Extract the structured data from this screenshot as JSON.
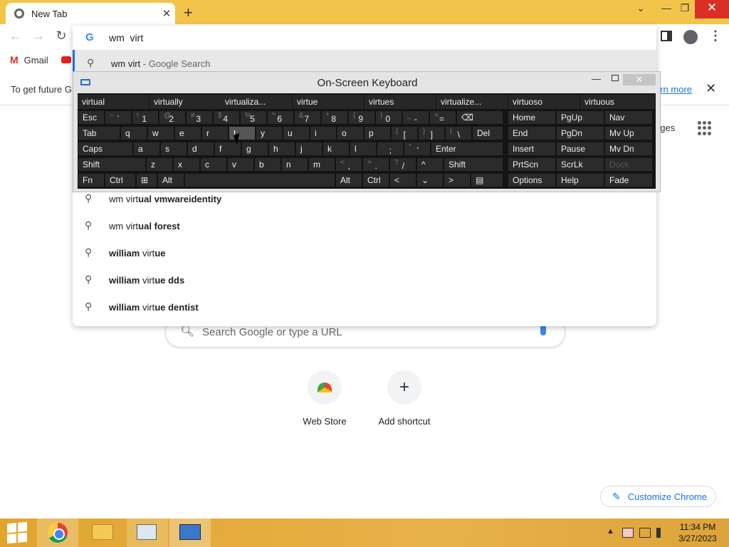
{
  "browser": {
    "tab_title": "New Tab",
    "tab_close": "✕",
    "new_tab": "+",
    "window_controls": {
      "chevron": "⌄",
      "minimize": "—",
      "maximize": "❐",
      "close": "✕"
    },
    "toolbar": {
      "back": "←",
      "forward": "→",
      "reload": "↻",
      "menu": "⋮"
    },
    "bookmarks": [
      {
        "label": "Gmail",
        "icon": "gmail-icon"
      },
      {
        "label": "",
        "icon": "youtube-icon"
      }
    ],
    "infobar": {
      "text": "To get future G",
      "link": "arn more",
      "close": "✕"
    }
  },
  "omnibox": {
    "g_logo": "G",
    "input_value": "wm  virt",
    "suggestions": [
      {
        "pre": "wm virt",
        "bold": "",
        "sub": " - Google Search"
      },
      {
        "pre": "wm virt",
        "bold": "ual vmwareidentity",
        "sub": ""
      },
      {
        "pre": "wm virt",
        "bold": "ual forest",
        "sub": ""
      },
      {
        "bold_pre": "william ",
        "pre": "virt",
        "bold": "ue",
        "sub": ""
      },
      {
        "bold_pre": "william ",
        "pre": "virt",
        "bold": "ue dds",
        "sub": ""
      },
      {
        "bold_pre": "william ",
        "pre": "virt",
        "bold": "ue dentist",
        "sub": ""
      }
    ]
  },
  "newtab": {
    "images_link": "ages",
    "search_placeholder": "Search Google or type a URL",
    "shortcuts": [
      {
        "label": "Web Store"
      },
      {
        "label": "Add shortcut",
        "glyph": "+"
      }
    ],
    "customize": "Customize Chrome"
  },
  "osk": {
    "title": "On-Screen Keyboard",
    "min": "—",
    "close": "✕",
    "predictions": [
      "virtual",
      "virtually",
      "virtualiza...",
      "virtue",
      "virtues",
      "virtualize...",
      "virtuoso",
      "virtuous"
    ],
    "keys": {
      "esc": "Esc",
      "tab": "Tab",
      "caps": "Caps",
      "shift_l": "Shift",
      "fn": "Fn",
      "ctrl_l": "Ctrl",
      "alt_l": "Alt",
      "del": "Del",
      "enter": "Enter",
      "shift_r": "Shift",
      "alt_r": "Alt",
      "ctrl_r": "Ctrl",
      "lt": "<",
      "down": "⌄",
      "gt": ">",
      "up": "^",
      "home": "Home",
      "pgup": "PgUp",
      "nav": "Nav",
      "end": "End",
      "pgdn": "PgDn",
      "mvup": "Mv Up",
      "insert": "Insert",
      "pause": "Pause",
      "mvdn": "Mv Dn",
      "prtscn": "PrtScn",
      "scrlk": "ScrLk",
      "dock": "Dock",
      "options": "Options",
      "help": "Help",
      "fade": "Fade",
      "row1": [
        [
          "~",
          "`"
        ],
        [
          "!",
          "1"
        ],
        [
          "@",
          "2"
        ],
        [
          "#",
          "3"
        ],
        [
          "$",
          "4"
        ],
        [
          "%",
          "5"
        ],
        [
          "^",
          "6"
        ],
        [
          "&",
          "7"
        ],
        [
          "*",
          "8"
        ],
        [
          "(",
          "9"
        ],
        [
          ")",
          "0"
        ],
        [
          "_",
          "-"
        ],
        [
          "+",
          "="
        ]
      ],
      "row2": [
        "q",
        "w",
        "e",
        "r",
        "t",
        "y",
        "u",
        "i",
        "o",
        "p"
      ],
      "row2_sym": [
        [
          "{",
          "["
        ],
        [
          "}",
          "]"
        ],
        [
          "|",
          "\\"
        ]
      ],
      "row3": [
        "a",
        "s",
        "d",
        "f",
        "g",
        "h",
        "j",
        "k",
        "l"
      ],
      "row3_sym": [
        [
          ":",
          ";"
        ],
        [
          "\"",
          "'"
        ]
      ],
      "row4": [
        "z",
        "x",
        "c",
        "v",
        "b",
        "n",
        "m"
      ],
      "row4_sym": [
        [
          "<",
          ","
        ],
        [
          ">",
          "."
        ],
        [
          "?",
          "/"
        ]
      ]
    }
  },
  "taskbar": {
    "time": "11:34 PM",
    "date": "3/27/2023",
    "tray_arrow": "▲"
  }
}
